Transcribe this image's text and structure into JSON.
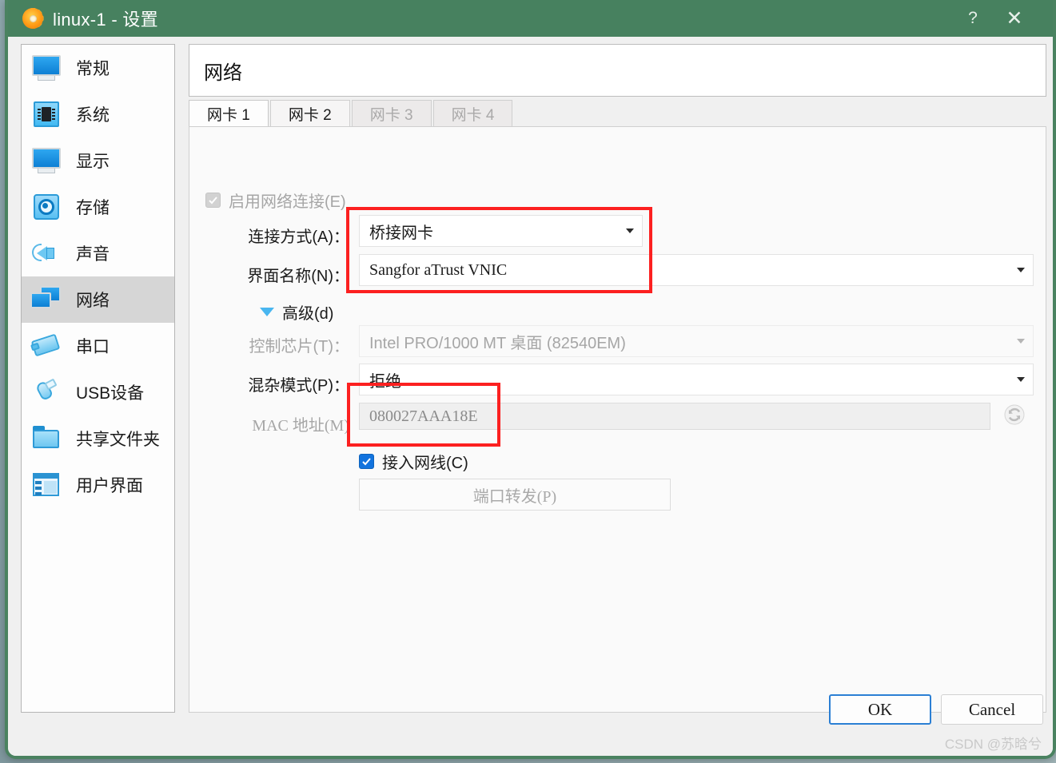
{
  "window": {
    "title": "linux-1 - 设置",
    "app_icon": "gear-icon",
    "help_label": "?",
    "close_label": "✕",
    "accent_title_color": "#47815f",
    "annotation_color": "#fc2020"
  },
  "sidebar": {
    "items": [
      {
        "label": "常规",
        "icon": "monitor-icon",
        "selected": false
      },
      {
        "label": "系统",
        "icon": "chip-icon",
        "selected": false
      },
      {
        "label": "显示",
        "icon": "monitor-icon",
        "selected": false
      },
      {
        "label": "存储",
        "icon": "harddisk-icon",
        "selected": false
      },
      {
        "label": "声音",
        "icon": "speaker-icon",
        "selected": false
      },
      {
        "label": "网络",
        "icon": "network-icon",
        "selected": true
      },
      {
        "label": "串口",
        "icon": "serial-port-icon",
        "selected": false
      },
      {
        "label": "USB设备",
        "icon": "usb-icon",
        "selected": false
      },
      {
        "label": "共享文件夹",
        "icon": "folder-icon",
        "selected": false
      },
      {
        "label": "用户界面",
        "icon": "window-icon",
        "selected": false
      }
    ]
  },
  "header": {
    "title": "网络"
  },
  "tabs": [
    {
      "label": "网卡 1",
      "state": "active"
    },
    {
      "label": "网卡 2",
      "state": "enabled"
    },
    {
      "label": "网卡 3",
      "state": "disabled"
    },
    {
      "label": "网卡 4",
      "state": "disabled"
    }
  ],
  "form": {
    "enable_network": {
      "label": "启用网络连接(E)",
      "checked": true,
      "disabled": true
    },
    "attached_to": {
      "label": "连接方式(A)：",
      "value": "桥接网卡"
    },
    "interface_name": {
      "label": "界面名称(N)：",
      "value": "Sangfor aTrust VNIC"
    },
    "advanced": {
      "label": "高级(d)",
      "expanded": true
    },
    "adapter_type": {
      "label": "控制芯片(T)：",
      "value": "Intel PRO/1000 MT 桌面 (82540EM)",
      "disabled": true
    },
    "promiscuous": {
      "label": "混杂模式(P)：",
      "value": "拒绝"
    },
    "mac_address": {
      "label": "MAC 地址(M)",
      "value": "080027AAA18E",
      "disabled": true,
      "refresh_icon": "refresh-icon"
    },
    "cable_connected": {
      "label": "接入网线(C)",
      "checked": true
    },
    "port_forwarding": {
      "label": "端口转发(P)",
      "disabled": true
    }
  },
  "footer": {
    "ok_label": "OK",
    "cancel_label": "Cancel"
  },
  "watermark": {
    "text": "CSDN @苏晗兮"
  }
}
